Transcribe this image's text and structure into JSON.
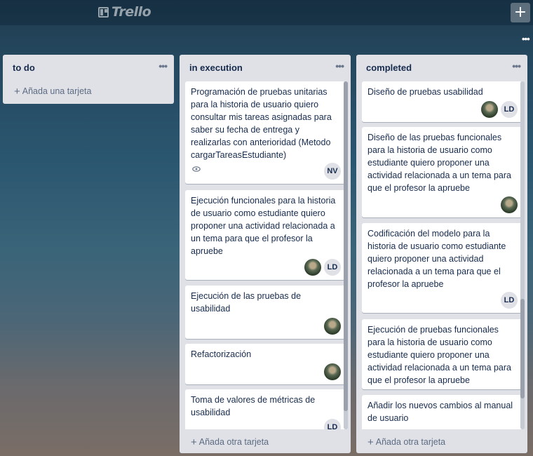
{
  "app": {
    "logo_text": "Trello",
    "add_button": "+",
    "menu_dots": "•••"
  },
  "lists": [
    {
      "title": "to do",
      "add_label": "Añada una tarjeta",
      "cards": []
    },
    {
      "title": "in execution",
      "add_label": "Añada otra tarjeta",
      "cards": [
        {
          "text": "Programación de pruebas unitarias para la historia de usuario quiero consultar mis tareas asignadas para saber su fecha de entrega y realizarlas con anterioridad (Metodo cargarTareasEstudiante)",
          "badge": "eye-icon",
          "members": [
            "NV"
          ]
        },
        {
          "text": "Ejecución funcionales para la historia de usuario como estudiante quiero proponer una actividad relacionada a un tema para que el profesor la apruebe",
          "members": [
            "photo",
            "LD"
          ]
        },
        {
          "text": "Ejecución de las pruebas de usabilidad",
          "members": [
            "photo"
          ]
        },
        {
          "text": "Refactorización",
          "members": [
            "photo"
          ]
        },
        {
          "text": "Toma de valores de métricas de usabilidad",
          "members": [
            "LD"
          ]
        }
      ]
    },
    {
      "title": "completed",
      "add_label": "Añada otra tarjeta",
      "cards": [
        {
          "text": "Diseño de pruebas usabilidad",
          "members": [
            "photo",
            "LD"
          ]
        },
        {
          "text": "Diseño de las pruebas funcionales para la historia de usuario como estudiante quiero proponer una actividad relacionada a un tema para que el profesor la apruebe",
          "members": [
            "photo"
          ]
        },
        {
          "text": "Codificación del modelo para la historia de usuario como estudiante quiero proponer una actividad relacionada a un tema para que el profesor la apruebe",
          "members": [
            "LD"
          ]
        },
        {
          "text": "Ejecución de pruebas funcionales para la historia de usuario como estudiante quiero proponer una actividad relacionada a un tema para que el profesor la apruebe",
          "members": []
        },
        {
          "text": "Añadir los nuevos cambios al manual de usuario",
          "members": []
        }
      ]
    }
  ],
  "member_initials": {
    "nv": "NV",
    "ld": "LD"
  }
}
